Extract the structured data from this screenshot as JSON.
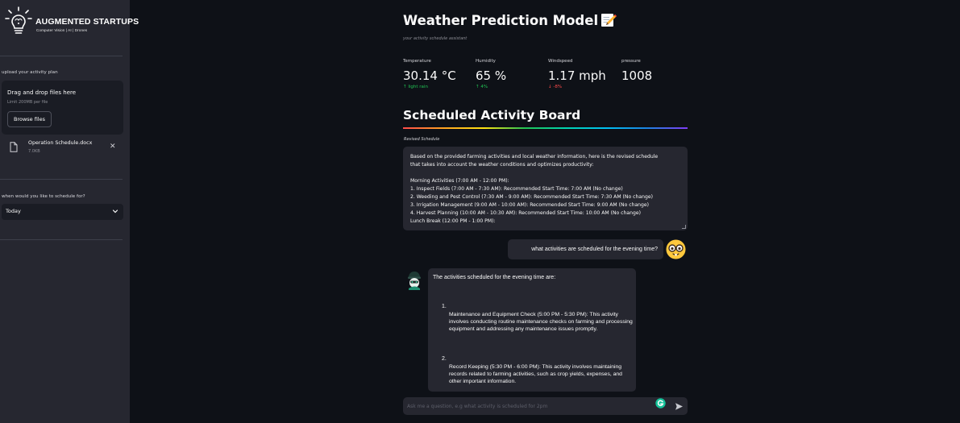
{
  "sidebar": {
    "logo": {
      "title": "AUGMENTED STARTUPS",
      "subtitle": "Computer Vision | AI | Drones",
      "icon": "lightbulb-brain-icon"
    },
    "upload_label": "upload your activity plan",
    "dropzone": {
      "title": "Drag and drop files here",
      "limit": "Limit 200MB per file",
      "browse_label": "Browse files"
    },
    "file": {
      "name": "Operation Schedule.docx",
      "size": "7.0KB",
      "close_label": "✕",
      "icon": "file-icon"
    },
    "schedule_label": "when would you like to schedule for?",
    "schedule_select": {
      "value": "Today",
      "icon": "chevron-down-icon"
    }
  },
  "header": {
    "title": "Weather Prediction Model",
    "title_icon": "memo-icon",
    "caption": "your activity schedule assistant"
  },
  "metrics": [
    {
      "label": "Temperature",
      "value": "30.14 °C",
      "delta": "↑ light rain",
      "direction": "up"
    },
    {
      "label": "Humidity",
      "value": "65 %",
      "delta": "↑ 4%",
      "direction": "up"
    },
    {
      "label": "Windspeed",
      "value": "1.17 mph",
      "delta": "↓ -8%",
      "direction": "down"
    },
    {
      "label": "pressure",
      "value": "1008",
      "delta": "",
      "direction": "none"
    }
  ],
  "board": {
    "title": "Scheduled Activity Board",
    "subcaption": "Revised Schedule",
    "lines": [
      "Based on the provided farming activities and local weather information, here is the revised schedule",
      "that takes into account the weather conditions and optimizes productivity:",
      "",
      "Morning Activities (7:00 AM - 12:00 PM):",
      "1. Inspect Fields (7:00 AM - 7:30 AM): Recommended Start Time: 7:00 AM (No change)",
      "2. Weeding and Pest Control (7:30 AM - 9:00 AM): Recommended Start Time: 7:30 AM (No change)",
      "3. Irrigation Management (9:00 AM - 10:00 AM): Recommended Start Time: 9:00 AM (No change)",
      "4. Harvest Planning (10:00 AM - 10:30 AM): Recommended Start Time: 10:00 AM (No change)",
      "Lunch Break (12:00 PM - 1:00 PM):"
    ]
  },
  "chat": {
    "user_message": "what activities are scheduled for the evening time?",
    "user_avatar": "nerd-face-icon",
    "bot_avatar": "robot-avatar-icon",
    "bot_intro": "The activities scheduled for the evening time are:",
    "bot_items": [
      {
        "num": "1.",
        "text": "Maintenance and Equipment Check (5:00 PM - 5:30 PM): This activity involves conducting routine maintenance checks on farming and processing equipment and addressing any maintenance issues promptly."
      },
      {
        "num": "2.",
        "text": "Record Keeping (5:30 PM - 6:00 PM): This activity involves maintaining records related to farming activities, such as crop yields, expenses, and other important information."
      }
    ],
    "input_placeholder": "Ask me a question, e.g what activity is scheduled for 2pm",
    "grammar_icon": "grammarly-icon",
    "send_icon": "send-icon"
  },
  "colors": {
    "background": "#0e1117",
    "panel": "#262730",
    "delta_up": "#21c354",
    "delta_down": "#ff4b4b"
  }
}
